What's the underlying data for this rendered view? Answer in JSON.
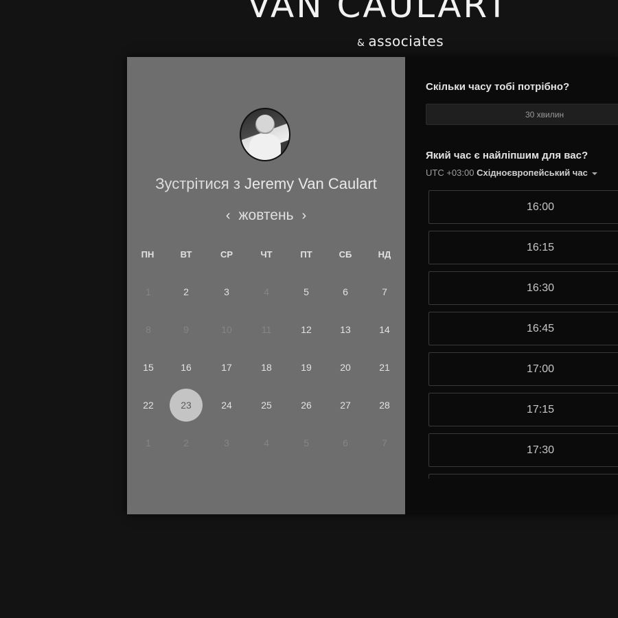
{
  "brand": {
    "title": "VAN CAULART",
    "subtitle_amp": "&",
    "subtitle": "associates"
  },
  "profile": {
    "meet_prefix": "Зустрітися з",
    "meet_name": "Jeremy Van Caulart"
  },
  "calendar": {
    "month": "жовтень",
    "prev_icon": "‹",
    "next_icon": "›",
    "weekdays": [
      "ПН",
      "ВТ",
      "СР",
      "ЧТ",
      "ПТ",
      "СБ",
      "НД"
    ],
    "weeks": [
      [
        {
          "d": "1",
          "m": true
        },
        {
          "d": "2",
          "m": false
        },
        {
          "d": "3",
          "m": false
        },
        {
          "d": "4",
          "m": true
        },
        {
          "d": "5",
          "m": false
        },
        {
          "d": "6",
          "m": false
        },
        {
          "d": "7",
          "m": false
        }
      ],
      [
        {
          "d": "8",
          "m": true
        },
        {
          "d": "9",
          "m": true
        },
        {
          "d": "10",
          "m": true
        },
        {
          "d": "11",
          "m": true
        },
        {
          "d": "12",
          "m": false
        },
        {
          "d": "13",
          "m": false
        },
        {
          "d": "14",
          "m": false
        }
      ],
      [
        {
          "d": "15",
          "m": false
        },
        {
          "d": "16",
          "m": false
        },
        {
          "d": "17",
          "m": false
        },
        {
          "d": "18",
          "m": false
        },
        {
          "d": "19",
          "m": false
        },
        {
          "d": "20",
          "m": false
        },
        {
          "d": "21",
          "m": false
        }
      ],
      [
        {
          "d": "22",
          "m": false
        },
        {
          "d": "23",
          "m": false,
          "selected": true
        },
        {
          "d": "24",
          "m": false
        },
        {
          "d": "25",
          "m": false
        },
        {
          "d": "26",
          "m": false
        },
        {
          "d": "27",
          "m": false
        },
        {
          "d": "28",
          "m": false
        }
      ],
      [
        {
          "d": "1",
          "m": true
        },
        {
          "d": "2",
          "m": true
        },
        {
          "d": "3",
          "m": true
        },
        {
          "d": "4",
          "m": true
        },
        {
          "d": "5",
          "m": true
        },
        {
          "d": "6",
          "m": true
        },
        {
          "d": "7",
          "m": true
        }
      ]
    ]
  },
  "booking": {
    "duration_question": "Скільки часу тобі потрібно?",
    "duration_value": "30 хвилин",
    "time_question": "Який час є найліпшим для вас?",
    "timezone_offset": "UTC +03:00",
    "timezone_name": "Східноєвропейський час",
    "slots": [
      "16:00",
      "16:15",
      "16:30",
      "16:45",
      "17:00",
      "17:15",
      "17:30",
      ""
    ]
  },
  "colors": {
    "page_bg": "#131313",
    "left_panel": "#6e6e6e",
    "right_panel": "#0b0b0b",
    "selected_day": "#c4c4c4"
  }
}
